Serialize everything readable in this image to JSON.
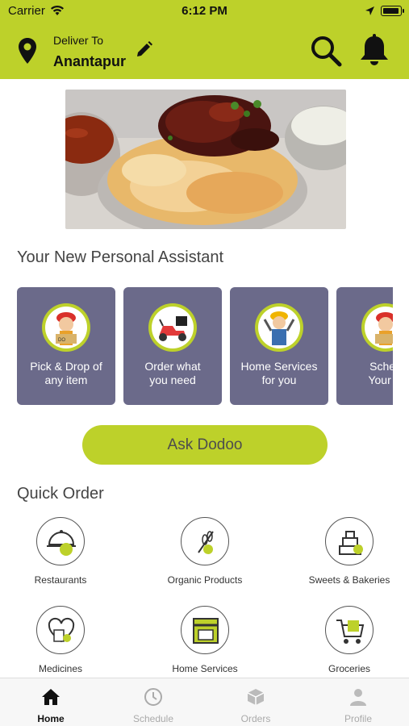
{
  "status_bar": {
    "carrier": "Carrier",
    "time": "6:12 PM"
  },
  "header": {
    "deliver_label": "Deliver To",
    "city": "Anantapur",
    "accent_color": "#bdd12a",
    "icons": [
      "location-pin-icon",
      "edit-pencil-icon",
      "search-icon",
      "bell-icon"
    ]
  },
  "banner": {
    "alt": "biryani-banner"
  },
  "assistant": {
    "title": "Your New Personal Assistant",
    "card_color": "#6b6a8a",
    "cards": [
      {
        "label": "Pick & Drop of\nany item",
        "icon": "delivery-person-icon"
      },
      {
        "label": "Order what\nyou need",
        "icon": "scooter-icon"
      },
      {
        "label": "Home Services\nfor you",
        "icon": "handyman-icon"
      },
      {
        "label": "Sched\nYour O",
        "icon": "delivery-person-icon"
      }
    ]
  },
  "ask_button": {
    "label": "Ask Dodoo"
  },
  "quick_order": {
    "title": "Quick Order",
    "items": [
      {
        "label": "Restaurants",
        "icon": "restaurant-cloche-icon"
      },
      {
        "label": "Organic Products",
        "icon": "organic-wheat-icon"
      },
      {
        "label": "Sweets & Bakeries",
        "icon": "cake-icon"
      },
      {
        "label": "Medicines",
        "icon": "medicine-icon"
      },
      {
        "label": "Home Services",
        "icon": "home-shop-icon"
      },
      {
        "label": "Groceries",
        "icon": "grocery-cart-icon"
      }
    ]
  },
  "tabbar": {
    "active": "Home",
    "tabs": [
      {
        "label": "Home",
        "icon": "home-icon"
      },
      {
        "label": "Schedule",
        "icon": "clock-icon"
      },
      {
        "label": "Orders",
        "icon": "box-icon"
      },
      {
        "label": "Profile",
        "icon": "user-icon"
      }
    ]
  }
}
